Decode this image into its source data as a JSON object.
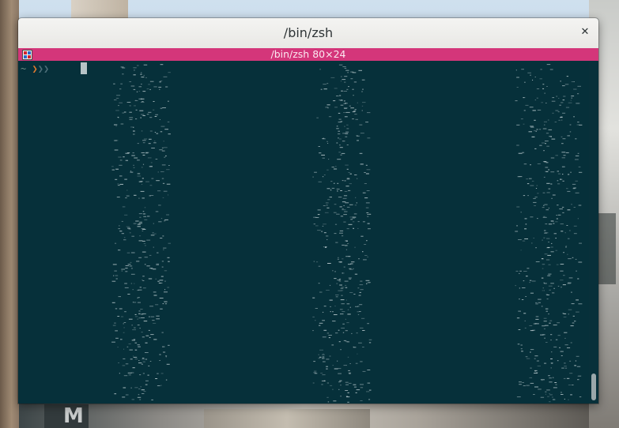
{
  "window": {
    "title": "/bin/zsh",
    "close_icon": "close-icon"
  },
  "tab": {
    "label": "/bin/zsh 80×24",
    "icon": "terminal-app-icon",
    "accent_color": "#d4367a"
  },
  "terminal": {
    "background_color": "#06303a",
    "prompt": {
      "tilde": "~",
      "arrows": [
        "❯",
        "❯",
        "❯"
      ],
      "arrow_colors": [
        "#e07a2e",
        "#4d6f79",
        "#4d6f79"
      ]
    },
    "text_color": "#d4e0e3"
  }
}
